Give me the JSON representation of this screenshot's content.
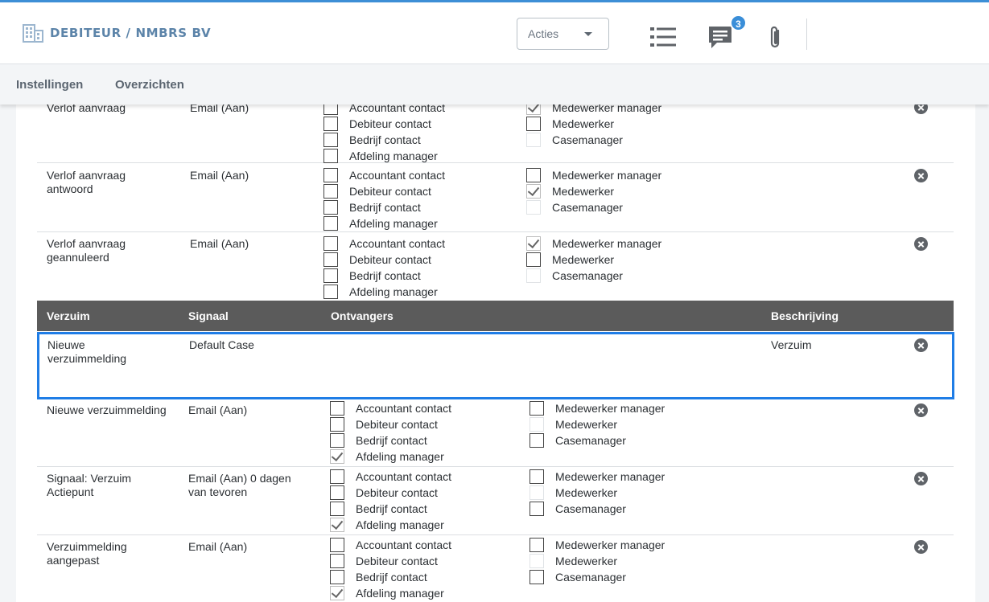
{
  "header": {
    "title": "DEBITEUR / NMBRS BV",
    "actions_label": "Acties",
    "chat_badge": "3",
    "icons": [
      "building-icon",
      "list-icon",
      "chat-icon",
      "paperclip-icon"
    ]
  },
  "subnav": {
    "items": [
      "Instellingen",
      "Overzichten"
    ]
  },
  "group_top": {
    "rows": [
      {
        "name": "Verlof aanvraag",
        "signal": "Email (Aan)",
        "left": [
          {
            "label": "Accountant contact",
            "state": "empty"
          },
          {
            "label": "Debiteur contact",
            "state": "empty"
          },
          {
            "label": "Bedrijf contact",
            "state": "empty"
          },
          {
            "label": "Afdeling manager",
            "state": "empty"
          }
        ],
        "right": [
          {
            "label": "Medewerker manager",
            "state": "checked"
          },
          {
            "label": "Medewerker",
            "state": "empty"
          },
          {
            "label": "Casemanager",
            "state": "light"
          }
        ]
      },
      {
        "name": "Verlof aanvraag antwoord",
        "signal": "Email (Aan)",
        "left": [
          {
            "label": "Accountant contact",
            "state": "empty"
          },
          {
            "label": "Debiteur contact",
            "state": "empty"
          },
          {
            "label": "Bedrijf contact",
            "state": "empty"
          },
          {
            "label": "Afdeling manager",
            "state": "empty"
          }
        ],
        "right": [
          {
            "label": "Medewerker manager",
            "state": "empty"
          },
          {
            "label": "Medewerker",
            "state": "checked"
          },
          {
            "label": "Casemanager",
            "state": "light"
          }
        ]
      },
      {
        "name": "Verlof aanvraag geannuleerd",
        "signal": "Email (Aan)",
        "left": [
          {
            "label": "Accountant contact",
            "state": "empty"
          },
          {
            "label": "Debiteur contact",
            "state": "empty"
          },
          {
            "label": "Bedrijf contact",
            "state": "empty"
          },
          {
            "label": "Afdeling manager",
            "state": "empty"
          }
        ],
        "right": [
          {
            "label": "Medewerker manager",
            "state": "checked"
          },
          {
            "label": "Medewerker",
            "state": "empty"
          },
          {
            "label": "Casemanager",
            "state": "light"
          }
        ]
      }
    ]
  },
  "group_verzuim": {
    "columns": {
      "name": "Verzuim",
      "signal": "Signaal",
      "receivers": "Ontvangers",
      "description": "Beschrijving"
    },
    "selected_row": {
      "name": "Nieuwe verzuimmelding",
      "signal": "Default Case",
      "description": "Verzuim"
    },
    "rows": [
      {
        "name": "Nieuwe verzuimmelding",
        "signal": "Email (Aan)",
        "left": [
          {
            "label": "Accountant contact",
            "state": "empty"
          },
          {
            "label": "Debiteur contact",
            "state": "empty"
          },
          {
            "label": "Bedrijf contact",
            "state": "empty"
          },
          {
            "label": "Afdeling manager",
            "state": "checked"
          }
        ],
        "right": [
          {
            "label": "Medewerker manager",
            "state": "empty"
          },
          {
            "label": "Medewerker",
            "state": "light"
          },
          {
            "label": "Casemanager",
            "state": "empty"
          }
        ]
      },
      {
        "name": "Signaal: Verzuim Actiepunt",
        "signal": "Email (Aan) 0 dagen van tevoren",
        "left": [
          {
            "label": "Accountant contact",
            "state": "empty"
          },
          {
            "label": "Debiteur contact",
            "state": "empty"
          },
          {
            "label": "Bedrijf contact",
            "state": "empty"
          },
          {
            "label": "Afdeling manager",
            "state": "checked"
          }
        ],
        "right": [
          {
            "label": "Medewerker manager",
            "state": "empty"
          },
          {
            "label": "Medewerker",
            "state": "light"
          },
          {
            "label": "Casemanager",
            "state": "empty"
          }
        ]
      },
      {
        "name": "Verzuimmelding aangepast",
        "signal": "Email (Aan)",
        "left": [
          {
            "label": "Accountant contact",
            "state": "empty"
          },
          {
            "label": "Debiteur contact",
            "state": "empty"
          },
          {
            "label": "Bedrijf contact",
            "state": "empty"
          },
          {
            "label": "Afdeling manager",
            "state": "checked"
          }
        ],
        "right": [
          {
            "label": "Medewerker manager",
            "state": "empty"
          },
          {
            "label": "Medewerker",
            "state": "light"
          },
          {
            "label": "Casemanager",
            "state": "empty"
          }
        ]
      }
    ]
  }
}
